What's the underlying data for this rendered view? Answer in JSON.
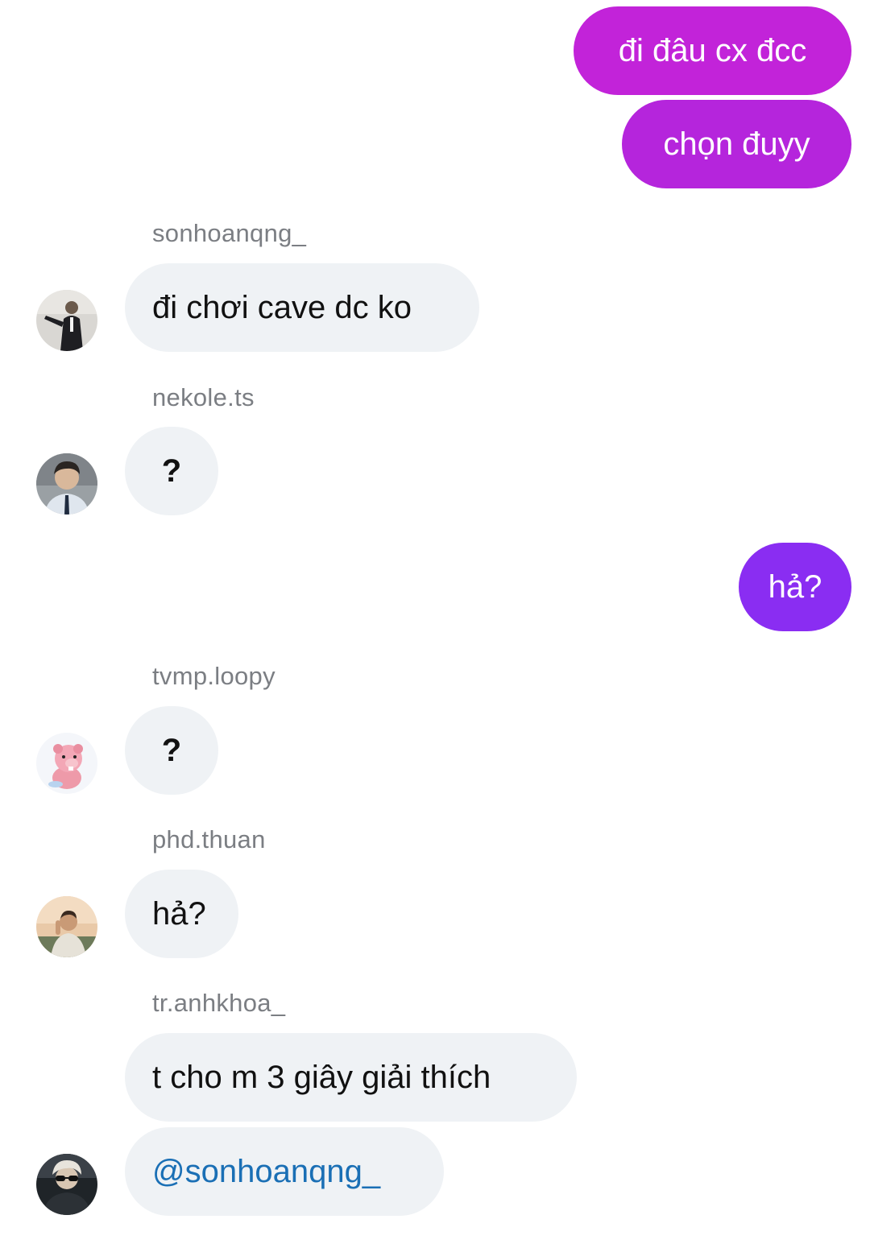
{
  "colors": {
    "outgoing_top": "#c026d8",
    "outgoing_bottom": "#8e2df0",
    "incoming_bg": "#eff2f5",
    "sender_name": "#7b7e83",
    "mention": "#1a6fb5"
  },
  "messages": [
    {
      "direction": "out",
      "text": "đi đâu cx đcc"
    },
    {
      "direction": "out",
      "text": "chọn đuyy"
    },
    {
      "direction": "in",
      "sender": "sonhoanqng_",
      "avatar": "avatar-man-in-suit",
      "text": "đi chơi cave dc ko"
    },
    {
      "direction": "in",
      "sender": "nekole.ts",
      "avatar": "avatar-young-man-shirt",
      "text": "?"
    },
    {
      "direction": "out",
      "text": "hả?"
    },
    {
      "direction": "in",
      "sender": "tvmp.loopy",
      "avatar": "avatar-pink-beaver",
      "text": "?"
    },
    {
      "direction": "in",
      "sender": "phd.thuan",
      "avatar": "avatar-man-sunset",
      "text": "hả?"
    },
    {
      "direction": "in",
      "sender": "tr.anhkhoa_",
      "avatar": "avatar-man-sunglasses",
      "text": "t cho m 3 giây giải thích"
    },
    {
      "direction": "in",
      "sender": "",
      "text": "@sonhoanqng_",
      "mention": true
    }
  ]
}
